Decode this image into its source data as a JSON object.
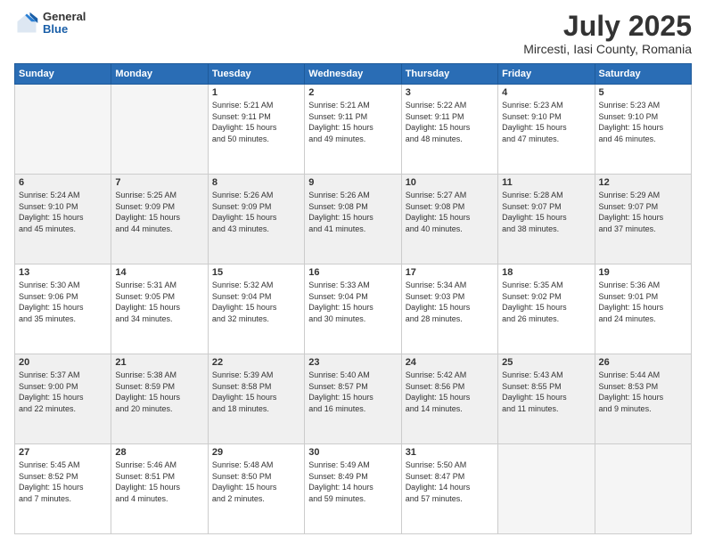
{
  "header": {
    "logo": {
      "general": "General",
      "blue": "Blue"
    },
    "month": "July 2025",
    "location": "Mircesti, Iasi County, Romania"
  },
  "weekdays": [
    "Sunday",
    "Monday",
    "Tuesday",
    "Wednesday",
    "Thursday",
    "Friday",
    "Saturday"
  ],
  "weeks": [
    [
      {
        "day": "",
        "info": ""
      },
      {
        "day": "",
        "info": ""
      },
      {
        "day": "1",
        "info": "Sunrise: 5:21 AM\nSunset: 9:11 PM\nDaylight: 15 hours\nand 50 minutes."
      },
      {
        "day": "2",
        "info": "Sunrise: 5:21 AM\nSunset: 9:11 PM\nDaylight: 15 hours\nand 49 minutes."
      },
      {
        "day": "3",
        "info": "Sunrise: 5:22 AM\nSunset: 9:11 PM\nDaylight: 15 hours\nand 48 minutes."
      },
      {
        "day": "4",
        "info": "Sunrise: 5:23 AM\nSunset: 9:10 PM\nDaylight: 15 hours\nand 47 minutes."
      },
      {
        "day": "5",
        "info": "Sunrise: 5:23 AM\nSunset: 9:10 PM\nDaylight: 15 hours\nand 46 minutes."
      }
    ],
    [
      {
        "day": "6",
        "info": "Sunrise: 5:24 AM\nSunset: 9:10 PM\nDaylight: 15 hours\nand 45 minutes."
      },
      {
        "day": "7",
        "info": "Sunrise: 5:25 AM\nSunset: 9:09 PM\nDaylight: 15 hours\nand 44 minutes."
      },
      {
        "day": "8",
        "info": "Sunrise: 5:26 AM\nSunset: 9:09 PM\nDaylight: 15 hours\nand 43 minutes."
      },
      {
        "day": "9",
        "info": "Sunrise: 5:26 AM\nSunset: 9:08 PM\nDaylight: 15 hours\nand 41 minutes."
      },
      {
        "day": "10",
        "info": "Sunrise: 5:27 AM\nSunset: 9:08 PM\nDaylight: 15 hours\nand 40 minutes."
      },
      {
        "day": "11",
        "info": "Sunrise: 5:28 AM\nSunset: 9:07 PM\nDaylight: 15 hours\nand 38 minutes."
      },
      {
        "day": "12",
        "info": "Sunrise: 5:29 AM\nSunset: 9:07 PM\nDaylight: 15 hours\nand 37 minutes."
      }
    ],
    [
      {
        "day": "13",
        "info": "Sunrise: 5:30 AM\nSunset: 9:06 PM\nDaylight: 15 hours\nand 35 minutes."
      },
      {
        "day": "14",
        "info": "Sunrise: 5:31 AM\nSunset: 9:05 PM\nDaylight: 15 hours\nand 34 minutes."
      },
      {
        "day": "15",
        "info": "Sunrise: 5:32 AM\nSunset: 9:04 PM\nDaylight: 15 hours\nand 32 minutes."
      },
      {
        "day": "16",
        "info": "Sunrise: 5:33 AM\nSunset: 9:04 PM\nDaylight: 15 hours\nand 30 minutes."
      },
      {
        "day": "17",
        "info": "Sunrise: 5:34 AM\nSunset: 9:03 PM\nDaylight: 15 hours\nand 28 minutes."
      },
      {
        "day": "18",
        "info": "Sunrise: 5:35 AM\nSunset: 9:02 PM\nDaylight: 15 hours\nand 26 minutes."
      },
      {
        "day": "19",
        "info": "Sunrise: 5:36 AM\nSunset: 9:01 PM\nDaylight: 15 hours\nand 24 minutes."
      }
    ],
    [
      {
        "day": "20",
        "info": "Sunrise: 5:37 AM\nSunset: 9:00 PM\nDaylight: 15 hours\nand 22 minutes."
      },
      {
        "day": "21",
        "info": "Sunrise: 5:38 AM\nSunset: 8:59 PM\nDaylight: 15 hours\nand 20 minutes."
      },
      {
        "day": "22",
        "info": "Sunrise: 5:39 AM\nSunset: 8:58 PM\nDaylight: 15 hours\nand 18 minutes."
      },
      {
        "day": "23",
        "info": "Sunrise: 5:40 AM\nSunset: 8:57 PM\nDaylight: 15 hours\nand 16 minutes."
      },
      {
        "day": "24",
        "info": "Sunrise: 5:42 AM\nSunset: 8:56 PM\nDaylight: 15 hours\nand 14 minutes."
      },
      {
        "day": "25",
        "info": "Sunrise: 5:43 AM\nSunset: 8:55 PM\nDaylight: 15 hours\nand 11 minutes."
      },
      {
        "day": "26",
        "info": "Sunrise: 5:44 AM\nSunset: 8:53 PM\nDaylight: 15 hours\nand 9 minutes."
      }
    ],
    [
      {
        "day": "27",
        "info": "Sunrise: 5:45 AM\nSunset: 8:52 PM\nDaylight: 15 hours\nand 7 minutes."
      },
      {
        "day": "28",
        "info": "Sunrise: 5:46 AM\nSunset: 8:51 PM\nDaylight: 15 hours\nand 4 minutes."
      },
      {
        "day": "29",
        "info": "Sunrise: 5:48 AM\nSunset: 8:50 PM\nDaylight: 15 hours\nand 2 minutes."
      },
      {
        "day": "30",
        "info": "Sunrise: 5:49 AM\nSunset: 8:49 PM\nDaylight: 14 hours\nand 59 minutes."
      },
      {
        "day": "31",
        "info": "Sunrise: 5:50 AM\nSunset: 8:47 PM\nDaylight: 14 hours\nand 57 minutes."
      },
      {
        "day": "",
        "info": ""
      },
      {
        "day": "",
        "info": ""
      }
    ]
  ]
}
